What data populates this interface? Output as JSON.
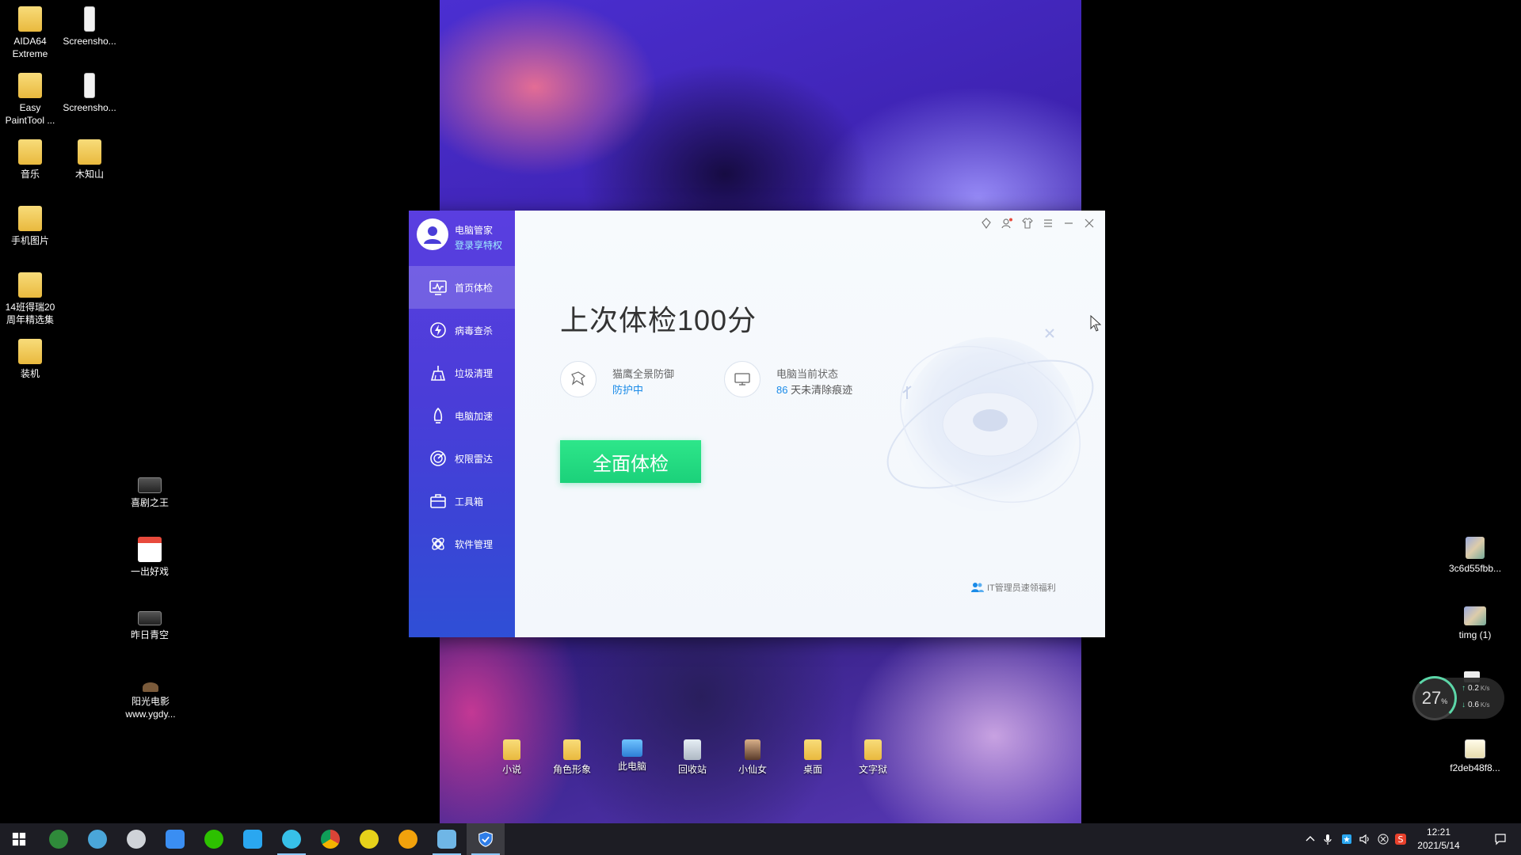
{
  "desktop": {
    "icons": [
      {
        "label": "AIDA64\nExtreme"
      },
      {
        "label": "Screensho..."
      },
      {
        "label": "Easy\nPaintTool ..."
      },
      {
        "label": "Screensho..."
      },
      {
        "label": "音乐"
      },
      {
        "label": "木知山"
      },
      {
        "label": "手机图片"
      },
      {
        "label": "14班得瑞20\n周年精选集"
      },
      {
        "label": "装机"
      },
      {
        "label": "喜剧之王"
      },
      {
        "label": "一出好戏"
      },
      {
        "label": "昨日青空"
      },
      {
        "label": "阳光电影\nwww.ygdy..."
      },
      {
        "label": "小说"
      },
      {
        "label": "角色形象"
      },
      {
        "label": "此电脑"
      },
      {
        "label": "回收站"
      },
      {
        "label": "小仙女"
      },
      {
        "label": "桌面"
      },
      {
        "label": "文字狱"
      },
      {
        "label": "3c6d55fbb..."
      },
      {
        "label": "timg (1)"
      },
      {
        "label": "f2deb48f8..."
      }
    ]
  },
  "app": {
    "name": "电脑管家",
    "login_text": "登录享特权",
    "nav": [
      {
        "label": "首页体检",
        "icon": "monitor-pulse-icon"
      },
      {
        "label": "病毒查杀",
        "icon": "lightning-shield-icon"
      },
      {
        "label": "垃圾清理",
        "icon": "broom-icon"
      },
      {
        "label": "电脑加速",
        "icon": "rocket-icon"
      },
      {
        "label": "权限雷达",
        "icon": "radar-icon"
      },
      {
        "label": "工具箱",
        "icon": "toolbox-icon"
      },
      {
        "label": "软件管理",
        "icon": "apps-icon"
      }
    ],
    "score_title": "上次体检100分",
    "protection": {
      "label": "猫鹰全景防御",
      "status": "防护中"
    },
    "pc_status": {
      "label": "电脑当前状态",
      "days": "86",
      "suffix": " 天未清除痕迹"
    },
    "scan_button": "全面体检",
    "it_link": "IT管理员速领福利"
  },
  "netwidget": {
    "cpu": "27",
    "cpu_unit": "%",
    "up": "0.2",
    "down": "0.6",
    "unit": "K/s"
  },
  "taskbar": {
    "time": "12:21",
    "date": "2021/5/14"
  },
  "colors": {
    "sidebar_top": "#5a3ee0",
    "sidebar_bottom": "#2f4fd6",
    "accent_blue": "#1a8be8",
    "scan_green": "#1bd17a"
  }
}
